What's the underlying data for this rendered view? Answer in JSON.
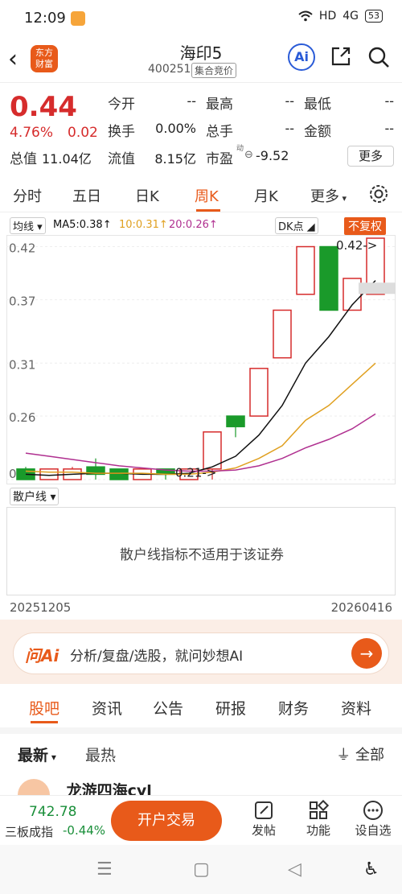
{
  "status": {
    "time": "12:09",
    "network": "HD",
    "signal": "4G",
    "battery": "53"
  },
  "header": {
    "title": "海印5",
    "code": "400251",
    "auction": "集合竞价",
    "logo_line1": "东方",
    "logo_line2": "财富",
    "ai_label": "Ai"
  },
  "quote": {
    "price": "0.44",
    "pct": "4.76%",
    "change": "0.02",
    "today_open_label": "今开",
    "today_open": "--",
    "high_label": "最高",
    "high": "--",
    "low_label": "最低",
    "low": "--",
    "turnover_label": "换手",
    "turnover": "0.00%",
    "volume_label": "总手",
    "volume": "--",
    "amount_label": "金额",
    "amount": "--",
    "mktcap_label": "总值",
    "mktcap": "11.04亿",
    "float_label": "流值",
    "float": "8.15亿",
    "pe_label": "市盈",
    "pe_sup": "动",
    "pe": "-9.52",
    "more": "更多"
  },
  "tabs": [
    "分时",
    "五日",
    "日K",
    "周K",
    "月K",
    "更多"
  ],
  "indicators": {
    "ma_select": "均线",
    "ma5": "MA5:0.38↑",
    "ma10": "10:0.31↑",
    "ma20": "20:0.26↑",
    "dk": "DK点",
    "adjust": "不复权"
  },
  "chart_data": {
    "type": "candlestick",
    "yticks": [
      "0.42",
      "0.37",
      "0.31",
      "0.26",
      "0.2"
    ],
    "ylim": [
      0.2,
      0.428
    ],
    "price_max_marker": "0.42->",
    "price_min_marker": "0.21->",
    "candles": [
      {
        "open": 0.21,
        "close": 0.2,
        "high": 0.212,
        "low": 0.2,
        "dir": "down"
      },
      {
        "open": 0.2,
        "close": 0.21,
        "high": 0.21,
        "low": 0.2,
        "dir": "up"
      },
      {
        "open": 0.2,
        "close": 0.21,
        "high": 0.212,
        "low": 0.2,
        "dir": "up"
      },
      {
        "open": 0.212,
        "close": 0.205,
        "high": 0.22,
        "low": 0.2,
        "dir": "down"
      },
      {
        "open": 0.21,
        "close": 0.2,
        "high": 0.21,
        "low": 0.2,
        "dir": "down"
      },
      {
        "open": 0.2,
        "close": 0.21,
        "high": 0.21,
        "low": 0.2,
        "dir": "up"
      },
      {
        "open": 0.21,
        "close": 0.205,
        "high": 0.21,
        "low": 0.2,
        "dir": "down"
      },
      {
        "open": 0.2,
        "close": 0.21,
        "high": 0.21,
        "low": 0.2,
        "dir": "up"
      },
      {
        "open": 0.21,
        "close": 0.245,
        "high": 0.245,
        "low": 0.2,
        "dir": "up"
      },
      {
        "open": 0.26,
        "close": 0.25,
        "high": 0.26,
        "low": 0.24,
        "dir": "down"
      },
      {
        "open": 0.26,
        "close": 0.305,
        "high": 0.305,
        "low": 0.26,
        "dir": "up"
      },
      {
        "open": 0.315,
        "close": 0.36,
        "high": 0.36,
        "low": 0.315,
        "dir": "up"
      },
      {
        "open": 0.375,
        "close": 0.42,
        "high": 0.42,
        "low": 0.375,
        "dir": "up"
      },
      {
        "open": 0.42,
        "close": 0.36,
        "high": 0.42,
        "low": 0.36,
        "dir": "down"
      },
      {
        "open": 0.36,
        "close": 0.39,
        "high": 0.39,
        "low": 0.36,
        "dir": "up"
      },
      {
        "open": 0.375,
        "close": 0.44,
        "high": 0.44,
        "low": 0.375,
        "dir": "up"
      }
    ],
    "series": [
      {
        "name": "MA5",
        "color": "#111111",
        "values": [
          0.205,
          0.204,
          0.205,
          0.206,
          0.206,
          0.205,
          0.205,
          0.206,
          0.212,
          0.222,
          0.242,
          0.27,
          0.31,
          0.335,
          0.365,
          0.388
        ]
      },
      {
        "name": "MA10",
        "color": "#e0a020",
        "values": [
          0.208,
          0.207,
          0.207,
          0.206,
          0.206,
          0.206,
          0.205,
          0.205,
          0.207,
          0.211,
          0.22,
          0.232,
          0.256,
          0.27,
          0.29,
          0.31
        ]
      },
      {
        "name": "MA20",
        "color": "#b03090",
        "values": [
          0.225,
          0.222,
          0.219,
          0.216,
          0.213,
          0.211,
          0.209,
          0.208,
          0.208,
          0.209,
          0.213,
          0.22,
          0.23,
          0.238,
          0.248,
          0.262
        ]
      }
    ]
  },
  "sanhu": {
    "select": "散户线",
    "message": "散户线指标不适用于该证券"
  },
  "dates": {
    "start": "20251205",
    "end": "20260416"
  },
  "ai_bar": {
    "logo": "问Ai",
    "text": "分析/复盘/选股，就问妙想AI",
    "go": "→"
  },
  "guba": {
    "tabs": [
      "股吧",
      "资讯",
      "公告",
      "研报",
      "财务",
      "资料"
    ],
    "sort_new": "最新",
    "sort_hot": "最热",
    "filter": "全部",
    "peek_user": "龙游四海cyl"
  },
  "bottom": {
    "index_value": "742.78",
    "index_name": "三板成指",
    "index_pct": "-0.44%",
    "trade": "开户交易",
    "post": "发帖",
    "func": "功能",
    "watch": "设自选"
  }
}
